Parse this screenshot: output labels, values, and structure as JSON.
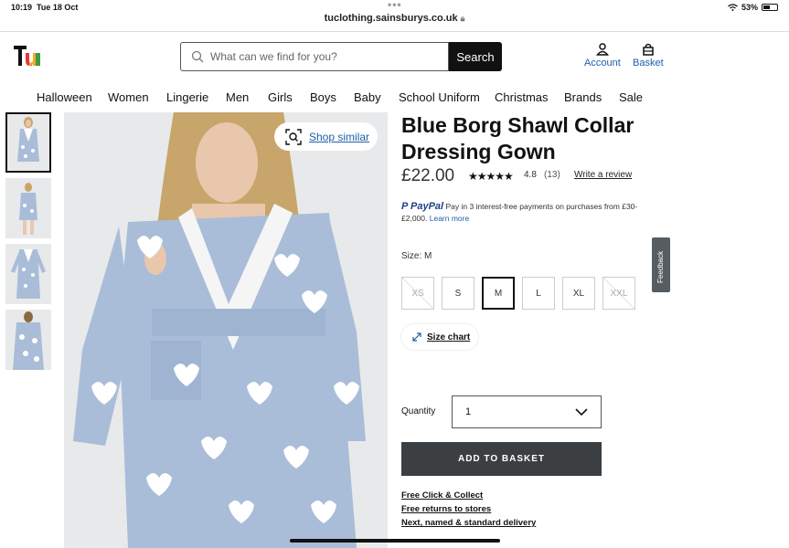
{
  "status": {
    "time": "10:19",
    "date": "Tue 18 Oct",
    "battery": "53%",
    "battery_level": 0.53
  },
  "browser": {
    "url": "tuclothing.sainsburys.co.uk"
  },
  "header": {
    "search_placeholder": "What can we find for you?",
    "search_button": "Search",
    "account_label": "Account",
    "basket_label": "Basket",
    "brand_colors": [
      "#e63a2e",
      "#f2a92b",
      "#3d9a46",
      "#111111"
    ]
  },
  "nav": {
    "items": [
      "Halloween",
      "Women",
      "Lingerie",
      "Men",
      "Girls",
      "Boys",
      "Baby",
      "School Uniform",
      "Christmas",
      "Brands",
      "Sale"
    ]
  },
  "gallery": {
    "shop_similar": "Shop similar",
    "thumbnail_count": 4
  },
  "product": {
    "title": "Blue Borg Shawl Collar Dressing Gown",
    "price": "£22.00",
    "stars": "★★★★★",
    "rating": "4.8",
    "review_count": "(13)",
    "write_review": "Write a review",
    "paypal_brand": "PayPal",
    "paypal_text": "Pay in 3 interest-free payments on purchases from £30-£2,000.",
    "paypal_learn": "Learn more",
    "size_label": "Size: M",
    "sizes": [
      "XS",
      "S",
      "M",
      "L",
      "XL",
      "XXL"
    ],
    "size_chart": "Size chart",
    "quantity_label": "Quantity",
    "quantity_value": "1",
    "add_to_basket": "ADD TO BASKET",
    "delivery": [
      "Free Click & Collect",
      "Free returns to stores",
      "Next, named & standard delivery"
    ],
    "colors": {
      "gown": "#a9bdd8",
      "hearts": "#ffffff",
      "skin": "#e9c7ad",
      "hair": "#c8a56a"
    }
  },
  "feedback": {
    "label": "Feedback"
  }
}
